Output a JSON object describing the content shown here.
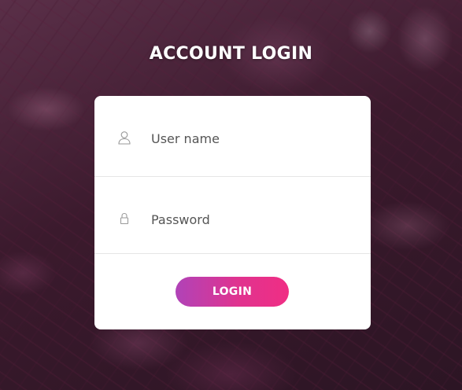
{
  "page": {
    "title": "ACCOUNT LOGIN"
  },
  "form": {
    "username": {
      "placeholder": "User name",
      "value": "",
      "icon": "user-icon"
    },
    "password": {
      "placeholder": "Password",
      "value": "",
      "icon": "lock-icon"
    },
    "submit_label": "LOGIN"
  },
  "colors": {
    "button_gradient_start": "#b043b8",
    "button_gradient_end": "#f02e84",
    "card_background": "#ffffff",
    "title_text": "#ffffff"
  }
}
